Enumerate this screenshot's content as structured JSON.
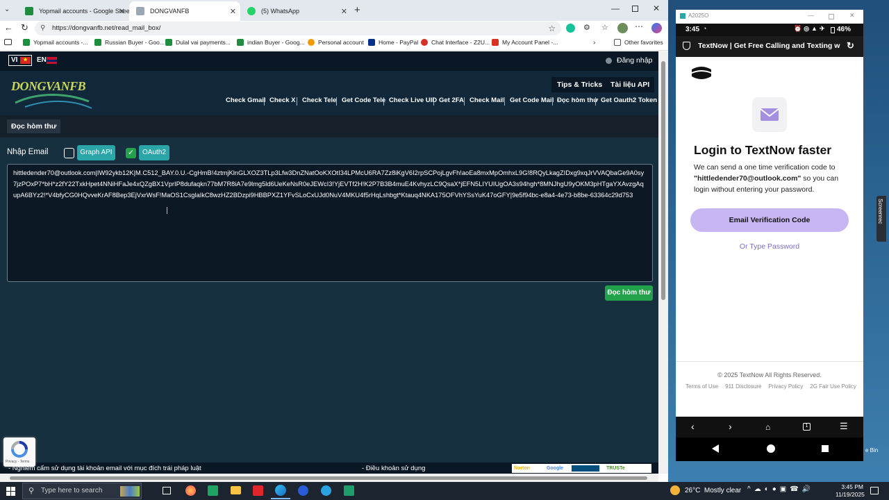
{
  "browser": {
    "tabs": [
      {
        "title": "Yopmail accounts - Google Sheets",
        "color": "#1e8e3e"
      },
      {
        "title": "DONGVANFB",
        "color": "#9aa8b6"
      },
      {
        "title": "(5) WhatsApp",
        "color": "#25d366"
      }
    ],
    "url": "https://dongvanfb.net/read_mail_box/",
    "bookmarks": [
      {
        "label": "Yopmail accounts -...",
        "color": "#1e8e3e"
      },
      {
        "label": "Russian Buyer - Goo...",
        "color": "#1e8e3e"
      },
      {
        "label": "Dulal vai payments...",
        "color": "#1e8e3e"
      },
      {
        "label": "indian Buyer - Goog...",
        "color": "#1e8e3e"
      },
      {
        "label": "Personal account",
        "color": "#f29900"
      },
      {
        "label": "Home - PayPal",
        "color": "#003087"
      },
      {
        "label": "Chat Interface - Z2U...",
        "color": "#d93025"
      },
      {
        "label": "My Account Panel -...",
        "color": "#d93025"
      }
    ],
    "other_favorites": "Other favorites"
  },
  "site": {
    "lang_vi": "VI",
    "lang_en": "EN",
    "login": "Đăng nhập",
    "logo": "DONGVANFB",
    "tips": "Tips & Tricks",
    "api_docs": "Tài liệu API",
    "nav": [
      "Check Gmail",
      "Check X",
      "Check Tele",
      "Get Code Tele",
      "Check Live UID",
      "Get 2FA",
      "Check Mail",
      "Get Code Mail",
      "Đọc hòm thư",
      "Get Oauth2 Token"
    ],
    "section_title": "Đọc hòm thư",
    "email_label": "Nhập Email",
    "graph_api": "Graph API",
    "oauth2": "OAuth2",
    "mail_input": "hittledender70@outlook.com|IW92ykb12K|M.C512_BAY.0.U.-CgHmB!4ztmjKlnGLXOZ3TLp3Lfw3DnZNatOoKXOtI34LPMcU6RA7Zz8iKgV6I2rpSCPojLgvFh!aoEa8mxMpOmhxL9G!8RQyLkagZIDxg9xqJrVVAQbaGe9A0sy7jzPOxP7*bH*z2fY22TxkHpet4NNiHFaJe4xQZgBX1VprIP8dufaqkn77bM7R8iA7e9lmg5ld6UeKeNsR0eJEWcI3!YjEVTf2H!K2P7B3B4muE4KvhyzLC9QsaX*jEFN5LIYUIUgOA3s94hgh*8MNJhgU9yOKM3pHTgaYXAvzgAqupA6BYz2!*V4bfyCG0HQvveKrAF8Bep3EjVxrWsF!MaOS1CsglaIkC8wzHZ2BDzpi9HBBPXZ1YFvSLoCxUJd0NuV4MKU4f5rHqLshbgt*Ktauq4NKA175OFVhYSsYuK47oGFY|9e5f94bc-e8a4-4e73-b8be-63364c29d753",
    "read_button": "Đọc hòm thư",
    "footer_left": "- Nghiêm cấm sử dụng tài khoản email với mục đích trái pháp luật",
    "footer_mid": "- Điều khoản sử dụng",
    "badges": [
      "Norton",
      "Google",
      "TRUSTe"
    ],
    "recaptcha": "Privacy - Terms"
  },
  "phone": {
    "window_title": "A2025O",
    "time": "3:45",
    "battery": "46%",
    "app_header": "TextNow | Get Free Calling and Texting with",
    "heading": "Login to TextNow faster",
    "desc_1": "We can send a one time verification code to",
    "email": "\"hittledender70@outlook.com\"",
    "desc_2": " so you can login without entering your password.",
    "verify_button": "Email Verification Code",
    "type_password": "Or Type Password",
    "copyright": "© 2025 TextNow All Rights Reserved.",
    "links": [
      "Terms of Use",
      "911 Disclosure",
      "Privacy Policy",
      "2G Fair Use Policy"
    ],
    "side_label": "Screenrec"
  },
  "taskbar": {
    "search": "Type here to search",
    "weather": "26°C  Mostly clear",
    "time": "3:45 PM",
    "date": "11/19/2025",
    "recycle": "e Bin"
  }
}
